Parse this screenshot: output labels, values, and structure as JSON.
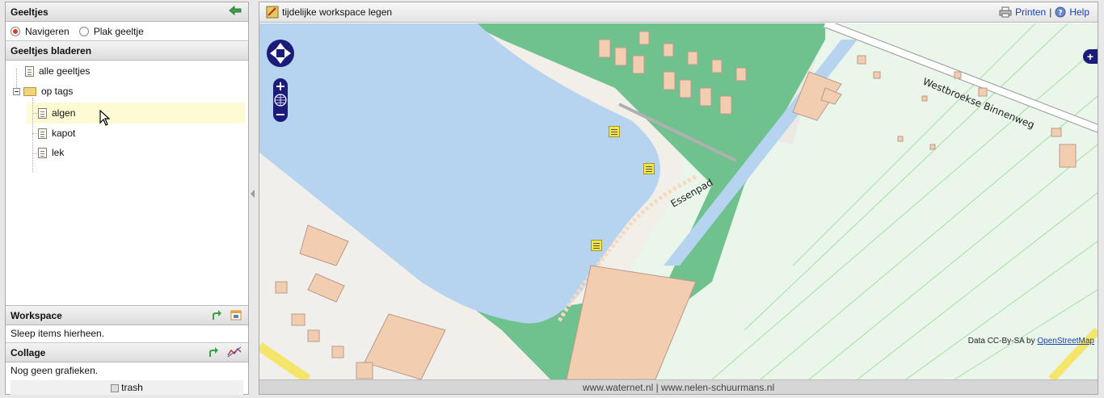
{
  "left_panel": {
    "title": "Geeltjes",
    "modes": [
      {
        "label": "Navigeren",
        "selected": true
      },
      {
        "label": "Plak geeltje",
        "selected": false
      }
    ],
    "browse_title": "Geeltjes bladeren",
    "tree": {
      "all": "alle geeltjes",
      "folder": "op tags",
      "tags": [
        "algen",
        "kapot",
        "lek"
      ],
      "selected": "algen"
    },
    "workspace": {
      "title": "Workspace",
      "hint": "Sleep items hierheen."
    },
    "collage": {
      "title": "Collage",
      "hint": "Nog geen grafieken.",
      "trash": "trash"
    }
  },
  "main": {
    "clear_workspace": "tijdelijke workspace legen",
    "print": "Printen",
    "separator": "|",
    "help": "Help",
    "map": {
      "street_1": "Westbroekse Binnenweg",
      "street_2": "Essenpad",
      "attribution_prefix": "Data CC-By-SA by",
      "attribution_link": "OpenStreetMap"
    },
    "footer": "www.waternet.nl | www.nelen-schuurmans.nl"
  },
  "colors": {
    "water": "#b6d3ef",
    "park": "#6fc18e",
    "building": "#f3cdb0",
    "nav": "#1b1b7a",
    "link": "#1a3fb0"
  }
}
